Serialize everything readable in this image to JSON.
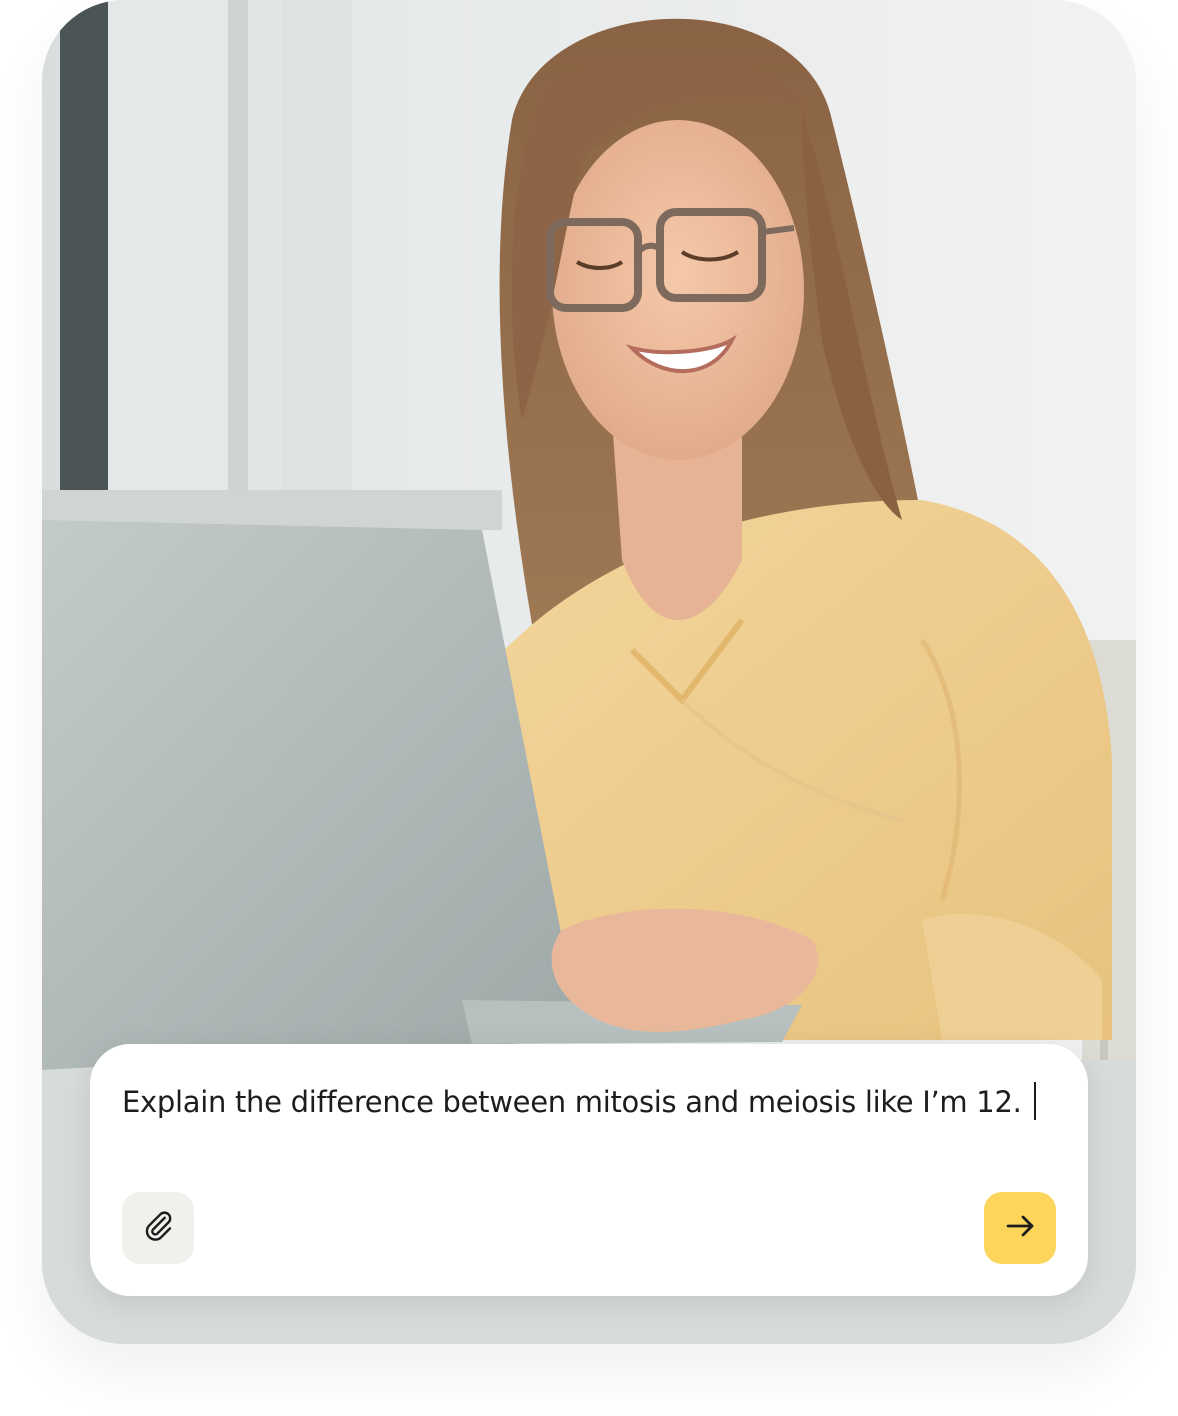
{
  "composer": {
    "prompt_text": "Explain the difference between mitosis and meiosis like I’m 12."
  },
  "icons": {
    "attach": "paperclip-icon",
    "send": "arrow-right-icon"
  },
  "colors": {
    "send_button": "#fcd55a",
    "attach_button": "#f0f0ed",
    "text": "#1d1d1d",
    "composer_background": "#ffffff"
  }
}
